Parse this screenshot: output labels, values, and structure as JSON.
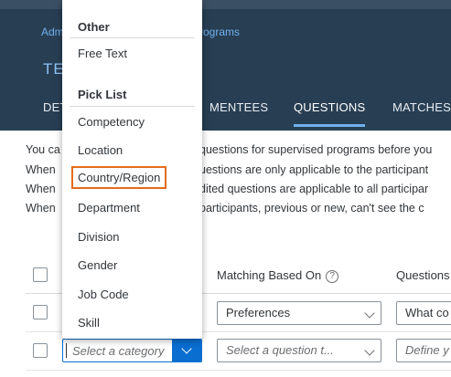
{
  "header": {
    "breadcrumb_left": "Adm",
    "breadcrumb_right": "rograms",
    "title": "TE",
    "tabs": [
      {
        "label": "DET"
      },
      {
        "label": "MENTEES"
      },
      {
        "label": "QUESTIONS"
      },
      {
        "label": "MATCHES"
      }
    ]
  },
  "description": {
    "lines_left": [
      "You ca",
      "When",
      "When",
      "When"
    ],
    "lines_right": [
      "questions for supervised programs before you",
      "uestions are only applicable to the participant",
      "dited questions are applicable to all participar",
      "participants, previous or new, can't see the c"
    ]
  },
  "table": {
    "col_matching": "Matching Based On",
    "col_questions": "Questions",
    "help_glyph": "?",
    "rows": [
      {
        "matching": "Preferences",
        "question": "What co"
      },
      {
        "category_placeholder": "Select a category",
        "matching_placeholder": "Select a question t...",
        "question_placeholder": "Define y"
      }
    ]
  },
  "dropdown": {
    "groups": [
      {
        "title": "Other",
        "items": [
          "Free Text"
        ]
      },
      {
        "title": "Pick List",
        "items": [
          "Competency",
          "Location",
          "Country/Region",
          "Department",
          "Division",
          "Gender",
          "Job Code",
          "Skill"
        ]
      }
    ],
    "highlighted_item": "Country/Region"
  },
  "colors": {
    "header_bg": "#283e53",
    "accent": "#0a6ed1",
    "highlight_border": "#e46c1d"
  }
}
